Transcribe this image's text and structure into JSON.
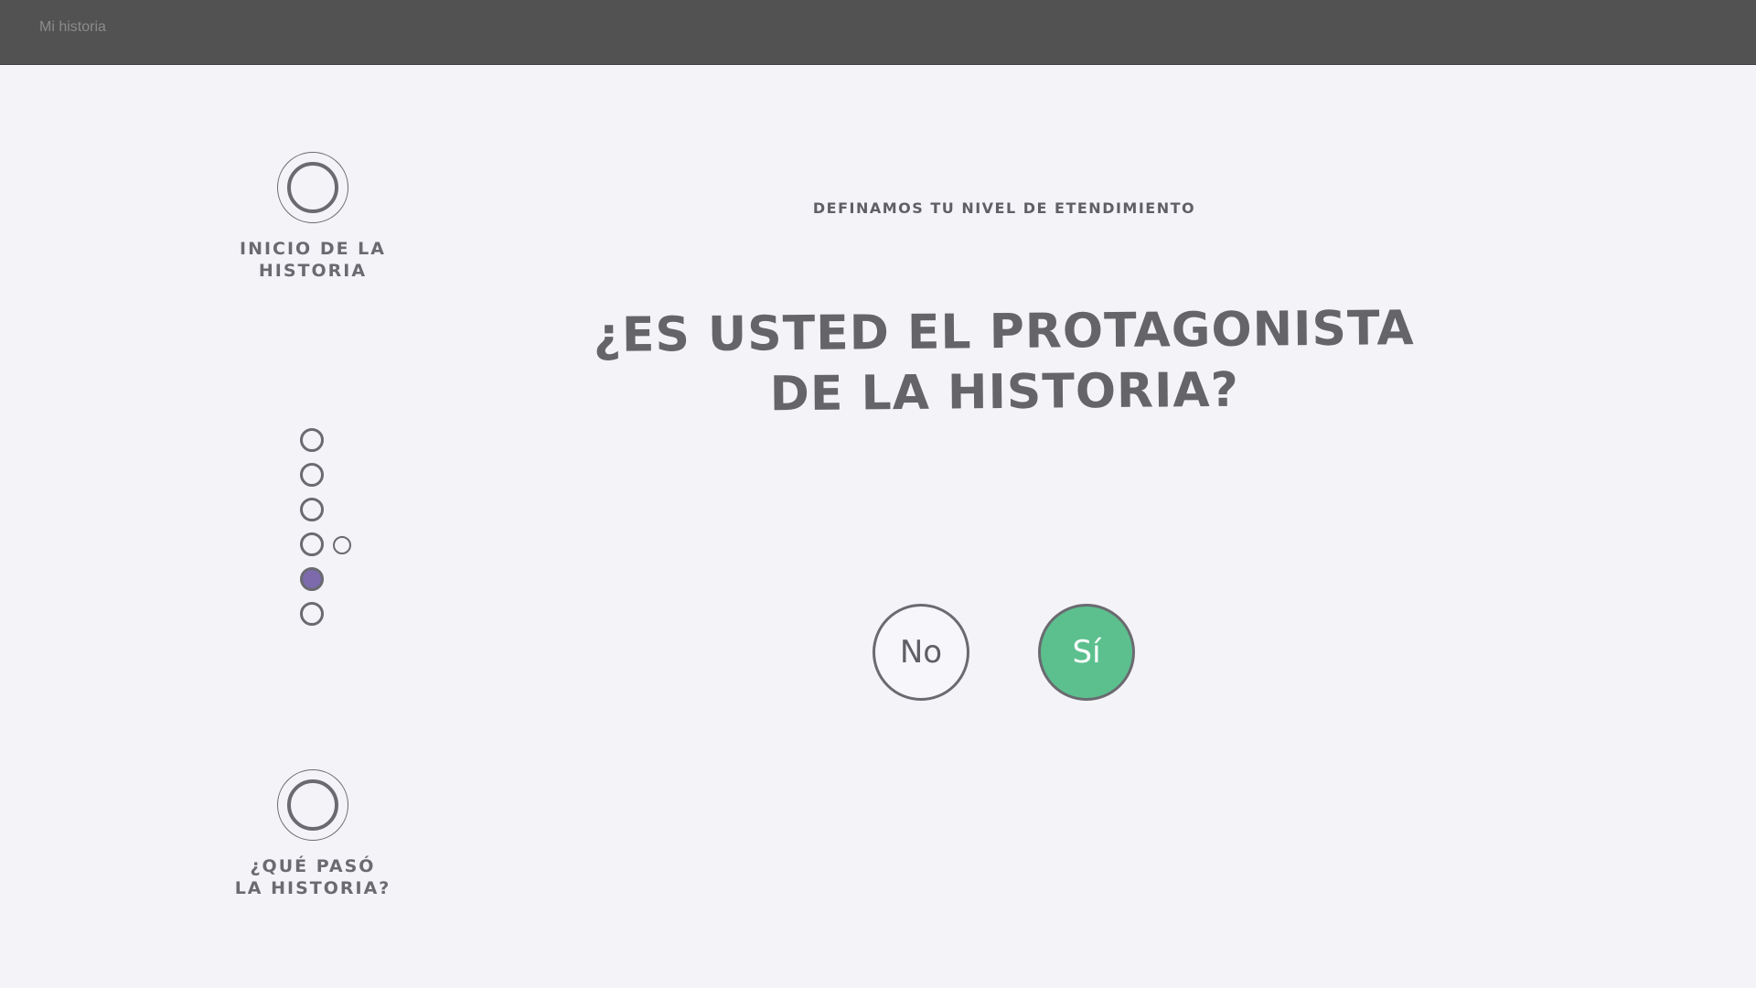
{
  "app": {
    "title": "Mi historia"
  },
  "sidebar": {
    "start": {
      "label": "INICIO DE LA\nHISTORIA"
    },
    "steps": [
      {
        "state": "empty",
        "has_sub": false
      },
      {
        "state": "empty",
        "has_sub": false
      },
      {
        "state": "empty",
        "has_sub": false
      },
      {
        "state": "empty",
        "has_sub": true
      },
      {
        "state": "active",
        "has_sub": false
      },
      {
        "state": "empty",
        "has_sub": false
      }
    ],
    "end": {
      "label": "¿QUÉ PASÓ\nLA HISTORIA?"
    }
  },
  "main": {
    "eyebrow": "DEFINAMOS TU NIVEL DE ETENDIMIENTO",
    "question": "¿Es usted el protagonista\nde la historia?",
    "answers": {
      "no": "No",
      "yes": "Sí"
    }
  },
  "colors": {
    "topbar": "#525252",
    "background": "#f4f3f8",
    "ink": "#6a6a70",
    "active_step": "#7c6aac",
    "yes_button": "#5cc08e"
  }
}
